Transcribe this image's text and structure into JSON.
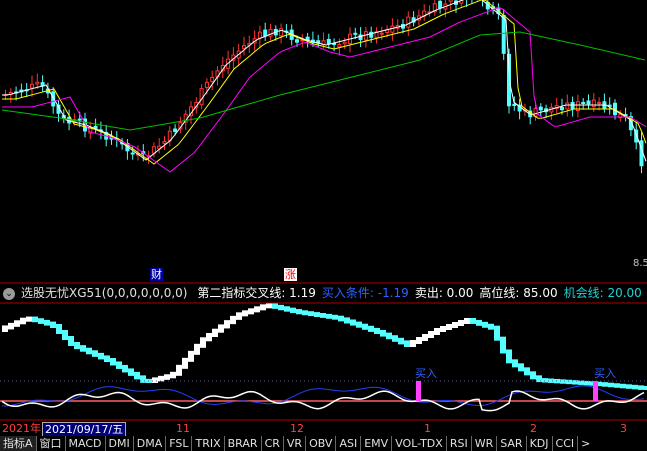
{
  "indicator": {
    "name": "选股无忧XG51(0,0,0,0,0,0,0)",
    "items": [
      {
        "label": "第二指标交叉线:",
        "value": "1.19",
        "color": "#ffffff"
      },
      {
        "label": "买入条件:",
        "value": "-1.19",
        "color": "#3060ff"
      },
      {
        "label": "卖出:",
        "value": "0.00",
        "color": "#ffffff"
      },
      {
        "label": "高位线:",
        "value": "85.00",
        "color": "#ffffff"
      },
      {
        "label": "机会线:",
        "value": "20.00",
        "color": "#20d0d0"
      },
      {
        "label": "底线:",
        "value": "",
        "color": "#ffd000"
      }
    ]
  },
  "badges": {
    "cai": "财",
    "zhang": "涨"
  },
  "price_label": "8.5",
  "signals": {
    "buy1": "买入",
    "buy2": "买入"
  },
  "dates": {
    "year": "2021年",
    "selected": "2021/09/17/五",
    "months": [
      "11",
      "12",
      "1",
      "2",
      "3"
    ]
  },
  "tabs": [
    "指标A",
    "窗口",
    "MACD",
    "DMI",
    "DMA",
    "FSL",
    "TRIX",
    "BRAR",
    "CR",
    "VR",
    "OBV",
    "ASI",
    "EMV",
    "VOL-TDX",
    "RSI",
    "WR",
    "SAR",
    "KDJ",
    "CCI"
  ],
  "tab_more": ">",
  "colors": {
    "up": "#ff3232",
    "down": "#54ffff",
    "ma5": "#ffffff",
    "ma10": "#ffff00",
    "ma20": "#ff00ff",
    "ma60": "#00c000"
  }
}
